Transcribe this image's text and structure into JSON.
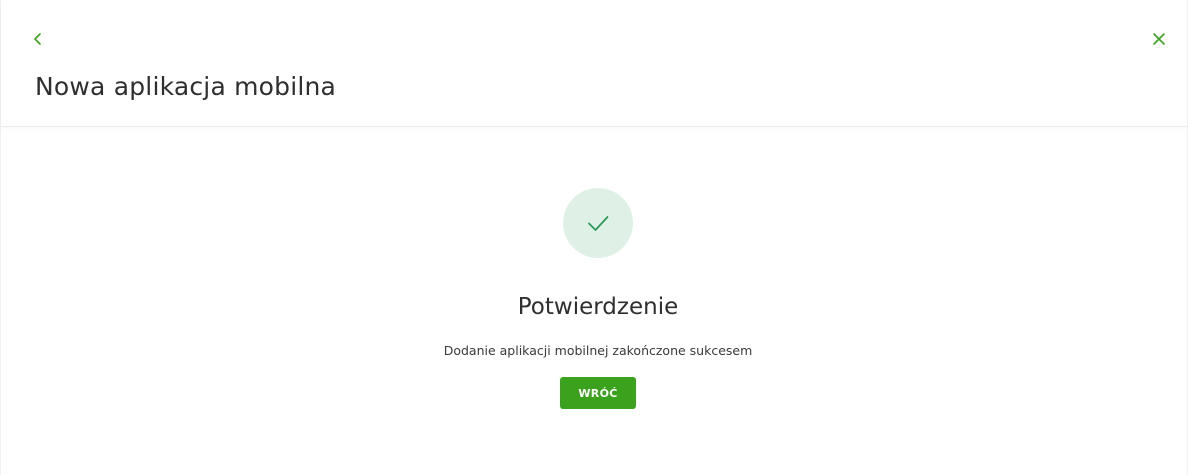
{
  "header": {
    "back_icon": "chevron-left-icon",
    "close_icon": "close-icon",
    "title": "Nowa aplikacja mobilna"
  },
  "confirmation": {
    "icon": "checkmark-icon",
    "title": "Potwierdzenie",
    "message": "Dodanie aplikacji mobilnej zakończone sukcesem",
    "button_label": "WRÓĆ"
  },
  "colors": {
    "accent_green": "#3ba21e",
    "icon_green": "#3ba21e",
    "success_circle_bg": "#dff1e6",
    "success_check": "#2a9a57",
    "text_dark": "#2f2f2f"
  }
}
